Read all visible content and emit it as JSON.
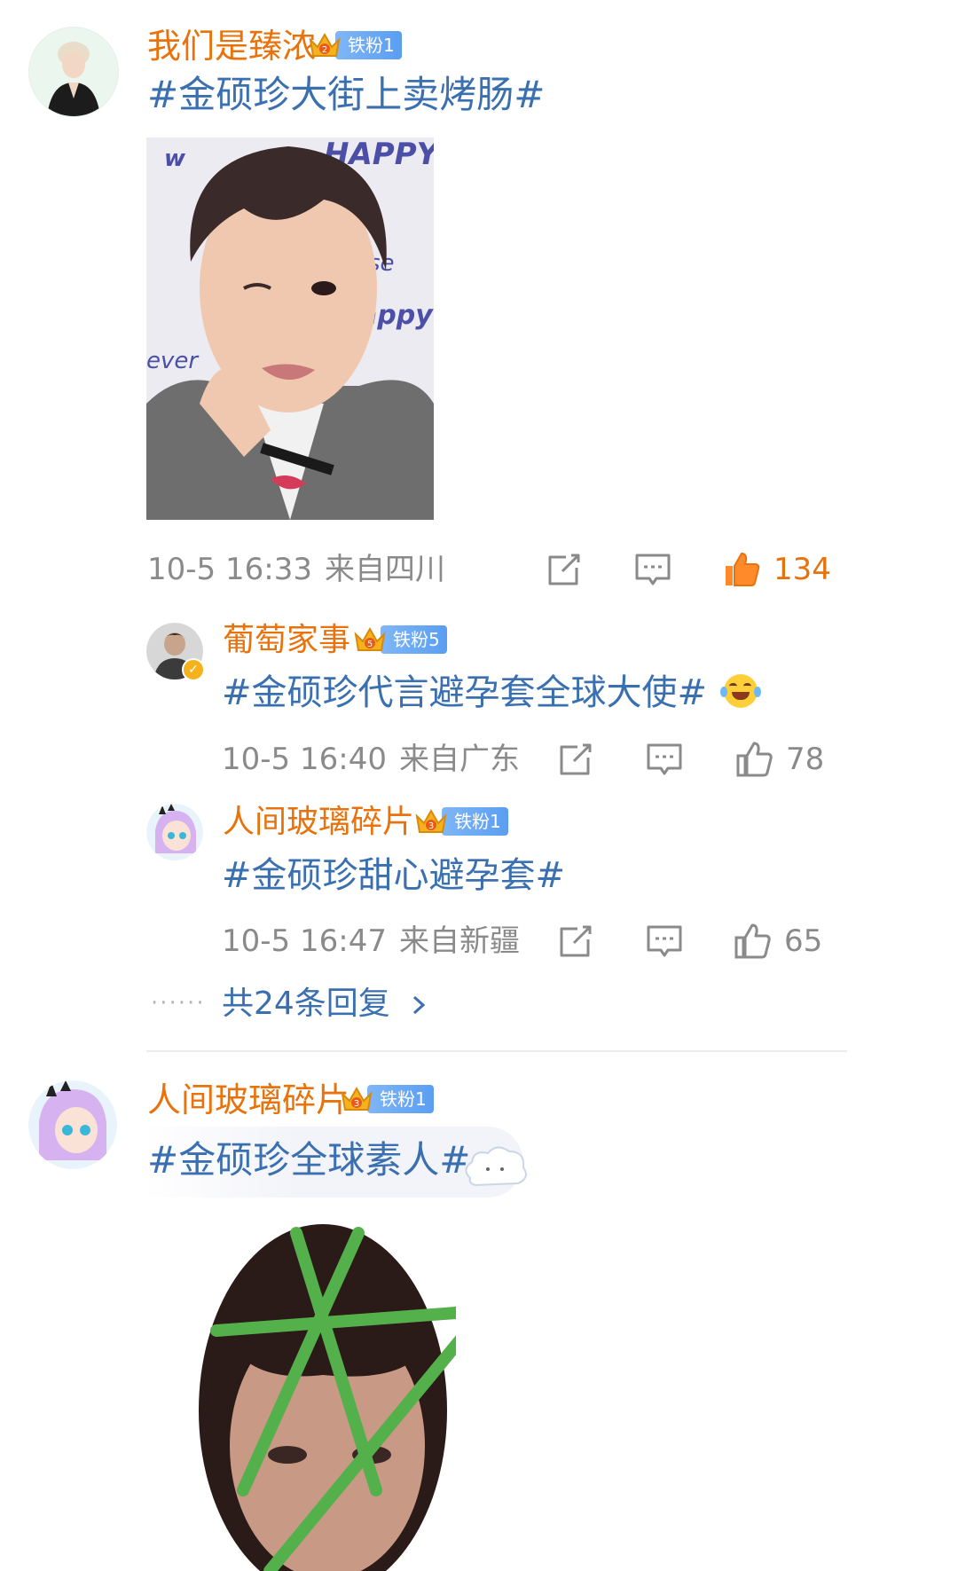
{
  "colors": {
    "username": "#e8720c",
    "topic": "#3a6fb0",
    "meta": "#8a8a8a",
    "badge": "#5a9ef2",
    "like_active": "#e8720c"
  },
  "comments": [
    {
      "username": "我们是臻浓",
      "badge_level": "2",
      "badge_label": "铁粉1",
      "text": "#金硕珍大街上卖烤肠#",
      "time": "10-5 16:33",
      "location": "来自四川",
      "likes": "134",
      "liked": true,
      "replies": [
        {
          "username": "葡萄家事",
          "badge_level": "5",
          "badge_label": "铁粉5",
          "text": "#金硕珍代言避孕套全球大使#",
          "emoji": "laugh-cry-emoji",
          "time": "10-5 16:40",
          "location": "来自广东",
          "likes": "78"
        },
        {
          "username": "人间玻璃碎片",
          "badge_level": "3",
          "badge_label": "铁粉1",
          "text": "#金硕珍甜心避孕套#",
          "time": "10-5 16:47",
          "location": "来自新疆",
          "likes": "65"
        }
      ],
      "more_replies": "共24条回复",
      "more_dots": "······"
    },
    {
      "username": "人间玻璃碎片",
      "badge_level": "3",
      "badge_label": "铁粉1",
      "text": "#金硕珍全球素人#"
    }
  ],
  "icons": {
    "share": "share-icon",
    "comment": "comment-icon",
    "like": "thumbs-up-icon",
    "more": "chevron-right-icon"
  }
}
